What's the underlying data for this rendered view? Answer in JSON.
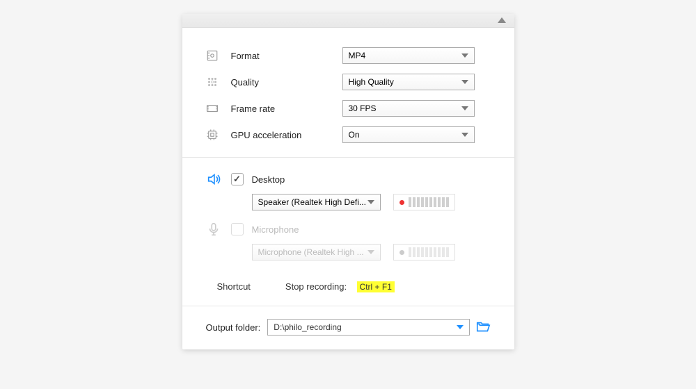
{
  "video": {
    "format_label": "Format",
    "format_value": "MP4",
    "quality_label": "Quality",
    "quality_value": "High Quality",
    "framerate_label": "Frame rate",
    "framerate_value": "30 FPS",
    "gpu_label": "GPU acceleration",
    "gpu_value": "On"
  },
  "audio": {
    "desktop_label": "Desktop",
    "desktop_device": "Speaker (Realtek High Defi...",
    "mic_label": "Microphone",
    "mic_device": "Microphone (Realtek High ..."
  },
  "shortcut": {
    "heading": "Shortcut",
    "stop_label": "Stop recording:",
    "stop_key": "Ctrl + F1"
  },
  "output": {
    "label": "Output folder:",
    "path": "D:\\philo_recording"
  }
}
